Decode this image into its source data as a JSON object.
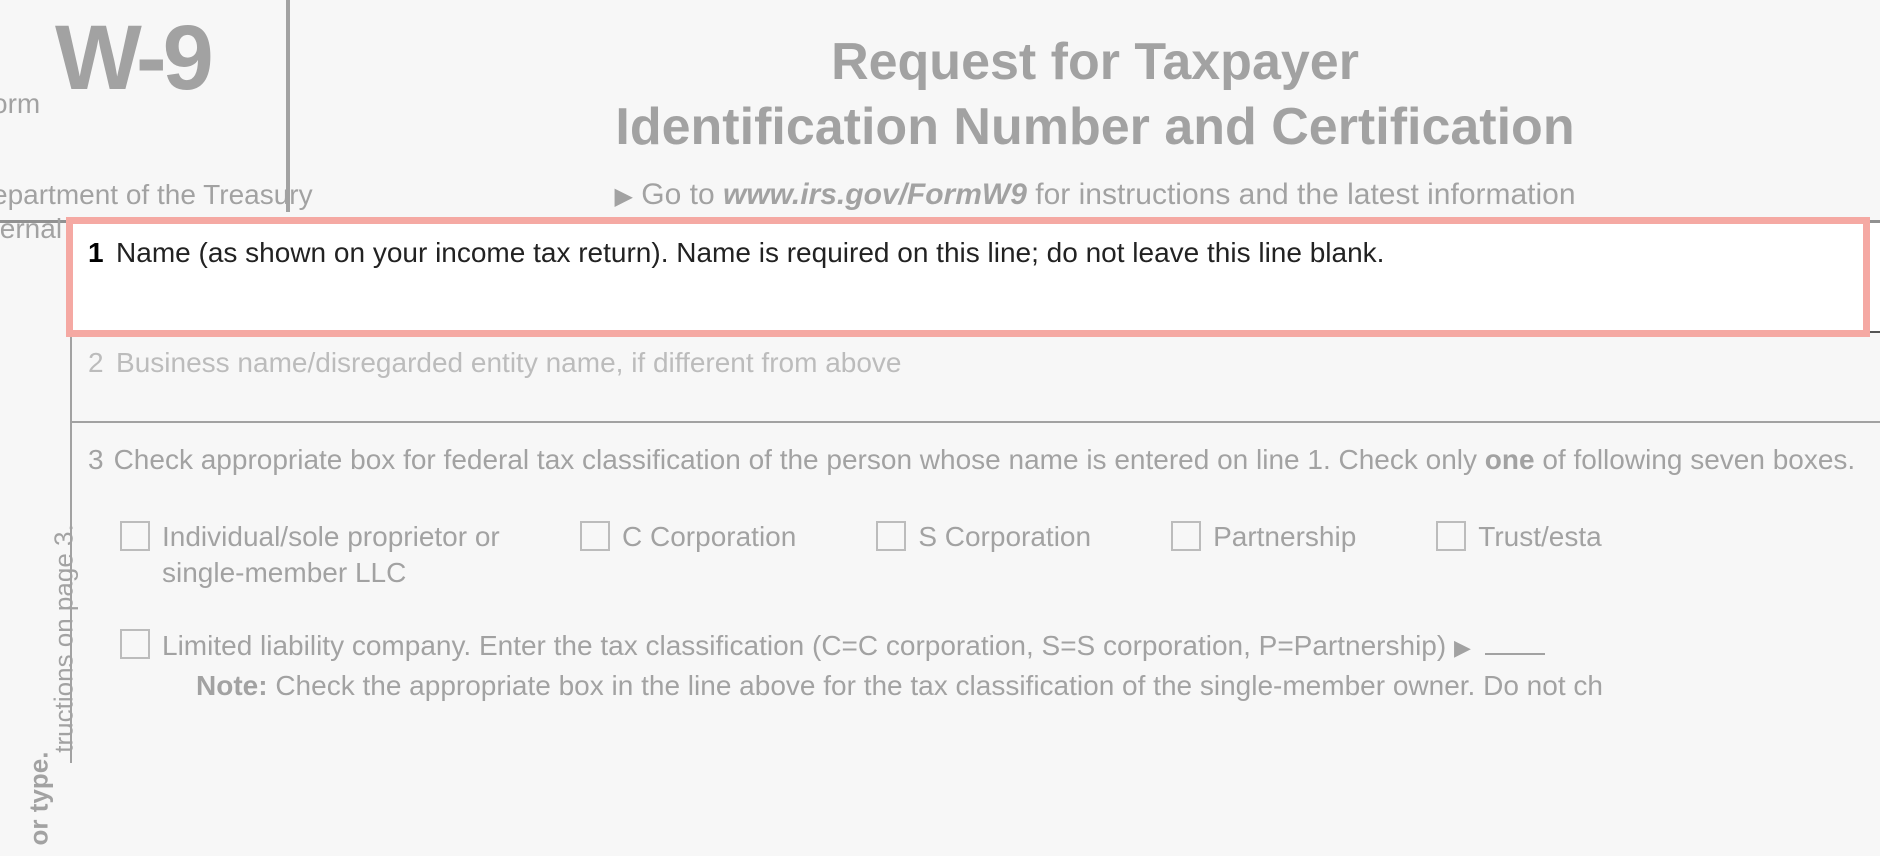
{
  "header": {
    "form_prefix": "orm",
    "form_code": "W-9",
    "department_line1": "epartment of the Treasury",
    "department_line2": "ternal Revenue Service",
    "title_line1": "Request for Taxpayer",
    "title_line2": "Identification Number and Certification",
    "instructions_arrow": "▶",
    "instructions_prefix": "Go to ",
    "instructions_url": "www.irs.gov/FormW9",
    "instructions_suffix": " for instructions and the latest information"
  },
  "sidebar": {
    "text_page3": "tructions on page 3.",
    "text_type": "or type."
  },
  "fields": {
    "line1": {
      "num": "1",
      "text": "Name (as shown on your income tax return). Name is required on this line; do not leave this line blank."
    },
    "line2": {
      "num": "2",
      "text": "Business name/disregarded entity name, if different from above"
    },
    "line3": {
      "num": "3",
      "intro": "Check appropriate box for federal tax classification of the person whose name is entered on line 1. Check only ",
      "bold_one": "one",
      "intro_suffix": " of following seven boxes.",
      "options": {
        "individual": "Individual/sole proprietor or single-member LLC",
        "c_corp": "C Corporation",
        "s_corp": "S Corporation",
        "partnership": "Partnership",
        "trust": "Trust/esta"
      },
      "llc_text": "Limited liability company. Enter the tax classification (C=C corporation, S=S corporation, P=Partnership)",
      "llc_arrow": "▶",
      "note_label": "Note:",
      "note_text": " Check the appropriate box in the line above for the tax classification of the single-member owner.  Do not ch"
    }
  }
}
